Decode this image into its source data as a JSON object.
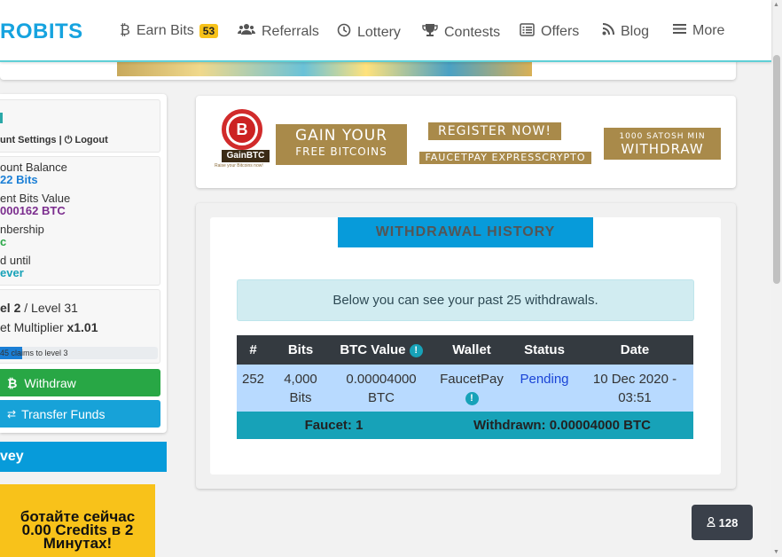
{
  "nav": {
    "logo": "ROBITS",
    "items": [
      {
        "icon": "bitcoin-icon",
        "glyph": "₿",
        "label": "Earn Bits",
        "badge": "53"
      },
      {
        "icon": "users-icon",
        "glyph": "👥",
        "label": "Referrals"
      },
      {
        "icon": "clock-icon",
        "glyph": "◷",
        "label": "Lottery"
      },
      {
        "icon": "trophy-icon",
        "glyph": "🏆",
        "label": "Contests"
      },
      {
        "icon": "list-icon",
        "glyph": "▤",
        "label": "Offers"
      },
      {
        "icon": "rss-icon",
        "glyph": "◔",
        "label": "Blog"
      },
      {
        "icon": "menu-icon",
        "glyph": "☰",
        "label": "More"
      }
    ]
  },
  "sidebar": {
    "account_links": "unt Settings | ⏻ Logout",
    "stats": {
      "balance_label": "ount Balance",
      "balance_value": "22 Bits",
      "bits_value_label": "ent Bits Value",
      "bits_value": "000162 BTC",
      "membership_label": "nbership",
      "membership_value": "c",
      "valid_until_label": "d until",
      "valid_until_value": "ever"
    },
    "level": {
      "current": "el 2",
      "max": " / Level 31",
      "multiplier_label": "et Multiplier ",
      "multiplier_value": "x1.01",
      "progress_text": "45 claims to level 3",
      "progress_fraction": 0.14
    },
    "withdraw_label": "Withdraw",
    "transfer_label": "Transfer Funds",
    "survey_label": "vey",
    "promo_lines": [
      "ботайте сейчас",
      "0.00 Credits в 2",
      "Минутах!"
    ]
  },
  "ad": {
    "logo_text": "GainBTC",
    "logo_sub": "Raise your Bitcoins now!",
    "gain_line1": "GAIN YOUR",
    "gain_line2": "FREE BITCOINS",
    "register": "REGISTER NOW!",
    "faucetpay": "FAUCETPAY EXPRESSCRYPTO",
    "min_line1": "1000 SATOSH MIN",
    "min_line2": "WITHDRAW"
  },
  "withdrawals": {
    "title": "WITHDRAWAL HISTORY",
    "alert": "Below you can see your past 25 withdrawals.",
    "headers": [
      "#",
      "Bits",
      "BTC Value",
      "Wallet",
      "Status",
      "Date"
    ],
    "rows": [
      {
        "id": "252",
        "bits": "4,000",
        "bits_unit": "Bits",
        "btc": "0.00004000",
        "btc_unit": "BTC",
        "wallet": "FaucetPay",
        "status": "Pending",
        "date_line1": "10 Dec 2020 -",
        "date_line2": "03:51"
      }
    ],
    "footer_faucet": "Faucet: 1",
    "footer_withdrawn": "Withdrawn: 0.00004000 BTC"
  },
  "online_count": "128",
  "colors": {
    "accent": "#079bda",
    "success": "#28a745",
    "pending": "#1a44d6",
    "dark": "#343a40"
  }
}
